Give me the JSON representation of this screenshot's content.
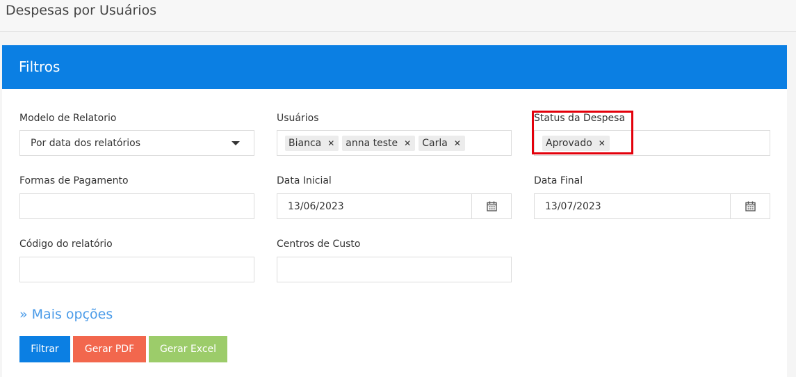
{
  "page": {
    "title": "Despesas por Usuários"
  },
  "panel": {
    "title": "Filtros",
    "header_color": "#0b7fe3"
  },
  "fields": {
    "modelo": {
      "label": "Modelo de Relatorio",
      "value": "Por data dos relatórios"
    },
    "usuarios": {
      "label": "Usuários",
      "chips": [
        "Bianca",
        "anna teste",
        "Carla"
      ]
    },
    "status": {
      "label": "Status da Despesa",
      "chips": [
        "Aprovado"
      ]
    },
    "formas": {
      "label": "Formas de Pagamento"
    },
    "data_inicial": {
      "label": "Data Inicial",
      "value": "13/06/2023"
    },
    "data_final": {
      "label": "Data Final",
      "value": "13/07/2023"
    },
    "codigo": {
      "label": "Código do relatório"
    },
    "centros": {
      "label": "Centros de Custo"
    }
  },
  "more_options": "» Mais opções",
  "buttons": {
    "filtrar": "Filtrar",
    "pdf": "Gerar PDF",
    "excel": "Gerar Excel"
  },
  "colors": {
    "primary": "#0b7fe3",
    "pdf": "#f2674d",
    "excel": "#9ccc6a",
    "highlight": "#e3000b",
    "link": "#4a9be8"
  },
  "icons": {
    "chip_remove": "close-icon",
    "date": "calendar-icon",
    "select": "caret-down-icon"
  }
}
